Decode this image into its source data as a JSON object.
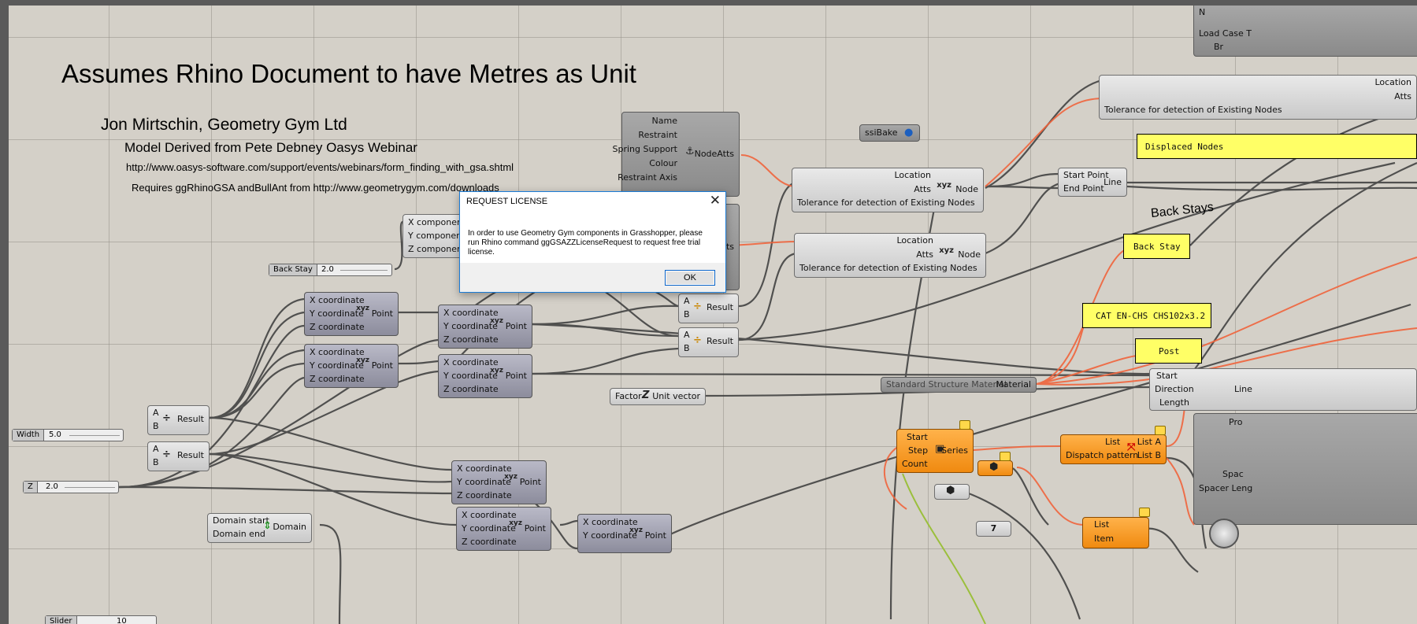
{
  "notes": {
    "heading": "Assumes Rhino Document to have Metres as Unit",
    "author": "Jon Mirtschin, Geometry Gym Ltd",
    "derived": "Model Derived from Pete Debney Oasys Webinar",
    "url": "http://www.oasys-software.com/support/events/webinars/form_finding_with_gsa.shtml",
    "requires": "Requires ggRhinoGSA andBullAnt from http://www.geometrygym.com/downloads",
    "back_stays": "Back Stays"
  },
  "labels": {
    "name": "Name",
    "restraint": "Restraint",
    "spring_support": "Spring Support",
    "colour": "Colour",
    "restraint_axis": "Restraint Axis",
    "nodeatts": "NodeAtts",
    "atts": "Atts",
    "location": "Location",
    "node": "Node",
    "tolerance": "Tolerance for detection of Existing Nodes",
    "x": "X coordinate",
    "y": "Y coordinate",
    "z": "Z coordinate",
    "point": "Point",
    "xc": "X component",
    "yc": "Y component",
    "zc": "Z component",
    "a": "A",
    "b": "B",
    "result": "Result",
    "start_point": "Start Point",
    "end_point": "End Point",
    "line": "Line",
    "start": "Start",
    "direction": "Direction",
    "length": "Length",
    "factor": "Factor",
    "unit_vector": "Unit vector",
    "material_source": "Standard Structure Material",
    "material": "Material",
    "step": "Step",
    "count": "Count",
    "series": "Series",
    "list": "List",
    "dispatch": "Dispatch pattern",
    "list_a": "List A",
    "list_b": "List B",
    "item": "Item",
    "domain_start": "Domain start",
    "domain_end": "Domain end",
    "domain": "Domain",
    "ssibake": "ssiBake",
    "nv": "N",
    "load_case": "Load Case T",
    "br": "Br",
    "pro": "Pro",
    "spac": "Spac",
    "spacer_len": "Spacer Leng",
    "seven": "7"
  },
  "panels": {
    "displaced": "Displaced Nodes",
    "back_stay": "Back Stay",
    "cat": "CAT EN-CHS CHS102x3.2",
    "post": "Post"
  },
  "sliders": {
    "back_stay_label": "Back Stay",
    "back_stay_value": "2.0",
    "width_label": "Width",
    "width_value": "5.0",
    "z_label": "Z",
    "z_value": "2.0",
    "slider_label": "Slider",
    "slider_value": "10"
  },
  "dialog": {
    "title": "REQUEST LICENSE",
    "close": "✕",
    "message": "In order to use Geometry Gym components in Grasshopper, please run Rhino command ggGSAZZLicenseRequest to request free trial license.",
    "ok": "OK"
  },
  "colors": {
    "canvas": "#d4d0c8",
    "wire": "#3a3a3a",
    "wire_selected": "#f0643c",
    "panel": "#ffff66",
    "cluster": "#f39a1f"
  }
}
